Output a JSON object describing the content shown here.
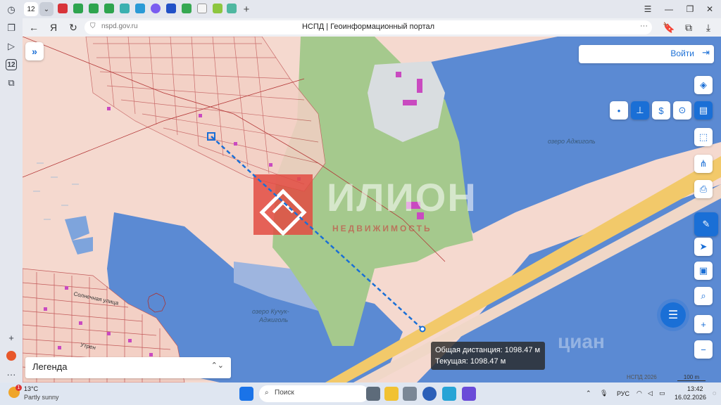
{
  "browser": {
    "tab_count": "12",
    "url": "nspd.gov.ru",
    "page_title": "НСПД | Геоинформационный портал",
    "sidebar_badge": "12"
  },
  "map": {
    "login_label": "Войти",
    "legend_label": "Легенда",
    "lake1_name": "озеро Аджиголь",
    "lake2_name_line1": "озеро Кучук-",
    "lake2_name_line2": "Аджиголь",
    "street1": "Солнечная улица",
    "street2": "Утрен",
    "watermark": "ИЛИОН",
    "watermark_sub": "НЕДВИЖИМОСТЬ",
    "tooltip_total": "Общая дистанция: 1098.47 м",
    "tooltip_current": "Текущая: 1098.47 м",
    "footer": "НСПД 2026",
    "scale": "100 m",
    "corner_mark": "циан"
  },
  "taskbar": {
    "weather_temp": "13°C",
    "weather_desc": "Partly sunny",
    "weather_badge": "1",
    "search_label": "Поиск",
    "lang": "РУС",
    "time": "13:42",
    "date": "16.02.2026"
  }
}
